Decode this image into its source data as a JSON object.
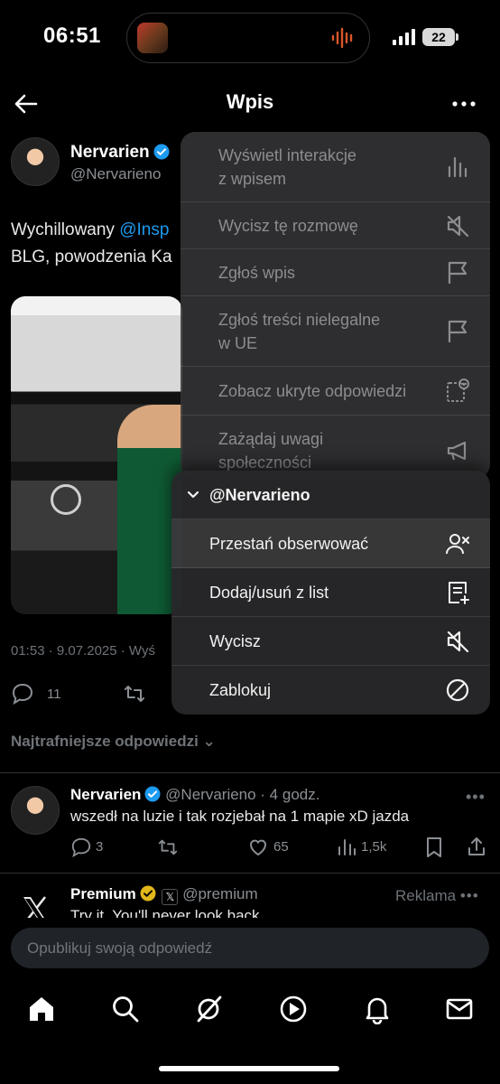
{
  "status_bar": {
    "time": "06:51",
    "battery": "22"
  },
  "header": {
    "title": "Wpis"
  },
  "tweet": {
    "name": "Nervarien",
    "handle": "@Nervarieno",
    "text_line1_prefix": "Wychillowany ",
    "text_line1_mention": "@Insp",
    "text_line2": "BLG, powodzenia Ka",
    "meta": "01:53 · 9.07.2025 · Wyś",
    "replies": "11"
  },
  "replies_section": {
    "label": "Najtrafniejsze odpowiedzi"
  },
  "reply": {
    "name": "Nervarien",
    "handle_time": "@Nervarieno · 4 godz.",
    "text": "wszedł na luzie i tak rozjebał na 1 mapie xD jazda",
    "replies": "3",
    "likes": "65",
    "views": "1,5k"
  },
  "ad": {
    "name": "Premium",
    "handle": "@premium",
    "label": "Reklama",
    "text": "Try it. You'll never look back."
  },
  "compose": {
    "placeholder": "Opublikuj swoją odpowiedź"
  },
  "menu": {
    "items": [
      {
        "label": "Wyświetl interakcje\nz wpisem",
        "icon": "bar-chart-icon"
      },
      {
        "label": "Wycisz tę rozmowę",
        "icon": "mute-icon"
      },
      {
        "label": "Zgłoś wpis",
        "icon": "flag-icon"
      },
      {
        "label": "Zgłoś treści nielegalne\nw UE",
        "icon": "flag-icon"
      },
      {
        "label": "Zobacz ukryte odpowiedzi",
        "icon": "hidden-replies-icon"
      },
      {
        "label": "Zażądaj uwagi\nspołeczności",
        "icon": "megaphone-icon"
      }
    ],
    "account_header": "@Nervarieno",
    "account_items": [
      {
        "label": "Przestań obserwować",
        "icon": "unfollow-icon"
      },
      {
        "label": "Dodaj/usuń z list",
        "icon": "list-add-icon"
      },
      {
        "label": "Wycisz",
        "icon": "mute-icon"
      },
      {
        "label": "Zablokuj",
        "icon": "block-icon"
      }
    ]
  },
  "colors": {
    "accent": "#1d9bf0",
    "background": "#000000",
    "menu": "#363638"
  }
}
